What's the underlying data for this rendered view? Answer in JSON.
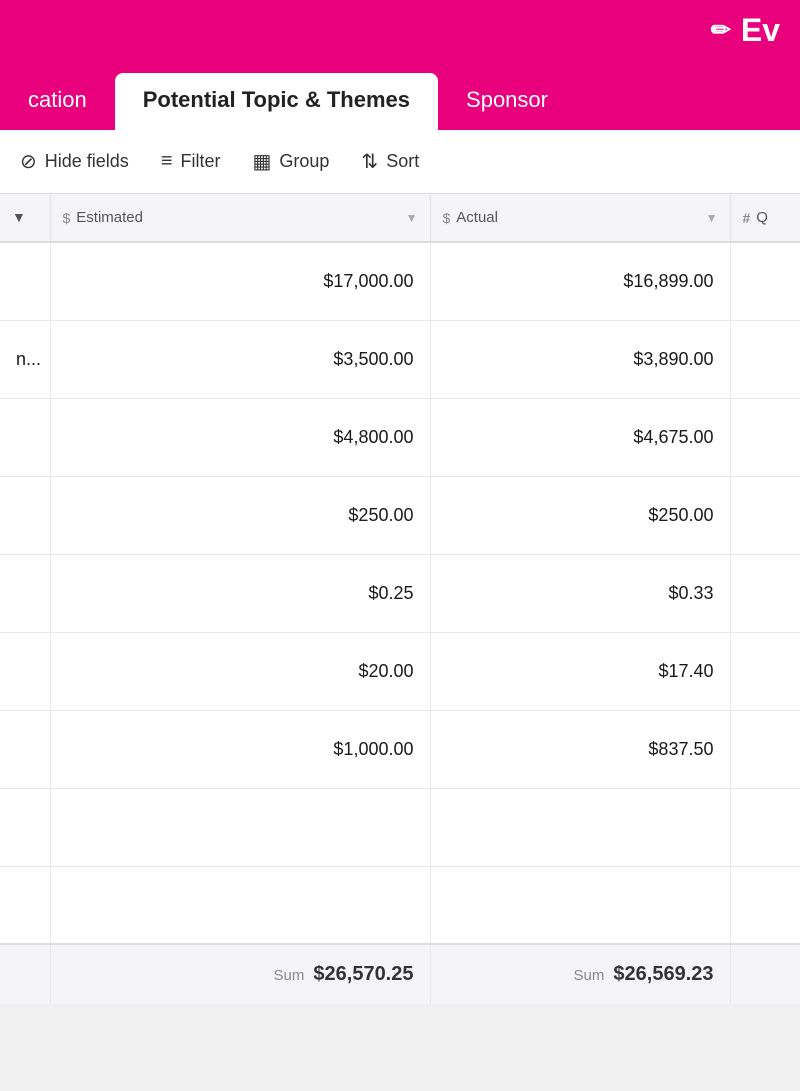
{
  "header": {
    "title": "Ev",
    "edit_icon": "✏"
  },
  "tabs": [
    {
      "id": "location",
      "label": "cation",
      "active": false
    },
    {
      "id": "topics",
      "label": "Potential Topic & Themes",
      "active": true
    },
    {
      "id": "sponsor",
      "label": "Sponsor",
      "active": false
    }
  ],
  "toolbar": {
    "hide_fields_label": "Hide fields",
    "filter_label": "Filter",
    "group_label": "Group",
    "sort_label": "Sort"
  },
  "table": {
    "columns": [
      {
        "id": "rownum",
        "label": "",
        "type": "dropdown"
      },
      {
        "id": "estimated",
        "label": "Estimated",
        "type": "currency"
      },
      {
        "id": "actual",
        "label": "Actual",
        "type": "currency"
      },
      {
        "id": "q",
        "label": "Q",
        "type": "number"
      }
    ],
    "rows": [
      {
        "rownum": "",
        "estimated": "$17,000.00",
        "actual": "$16,899.00",
        "partial": ""
      },
      {
        "rownum": "n...",
        "estimated": "$3,500.00",
        "actual": "$3,890.00",
        "partial": "n..."
      },
      {
        "rownum": "",
        "estimated": "$4,800.00",
        "actual": "$4,675.00",
        "partial": ""
      },
      {
        "rownum": "",
        "estimated": "$250.00",
        "actual": "$250.00",
        "partial": ""
      },
      {
        "rownum": "",
        "estimated": "$0.25",
        "actual": "$0.33",
        "partial": ""
      },
      {
        "rownum": "",
        "estimated": "$20.00",
        "actual": "$17.40",
        "partial": ""
      },
      {
        "rownum": "",
        "estimated": "$1,000.00",
        "actual": "$837.50",
        "partial": ""
      },
      {
        "rownum": "",
        "estimated": "",
        "actual": "",
        "partial": ""
      },
      {
        "rownum": "",
        "estimated": "",
        "actual": "",
        "partial": ""
      }
    ],
    "sum": {
      "label": "Sum",
      "estimated": "$26,570.25",
      "actual": "$26,569.23"
    }
  }
}
